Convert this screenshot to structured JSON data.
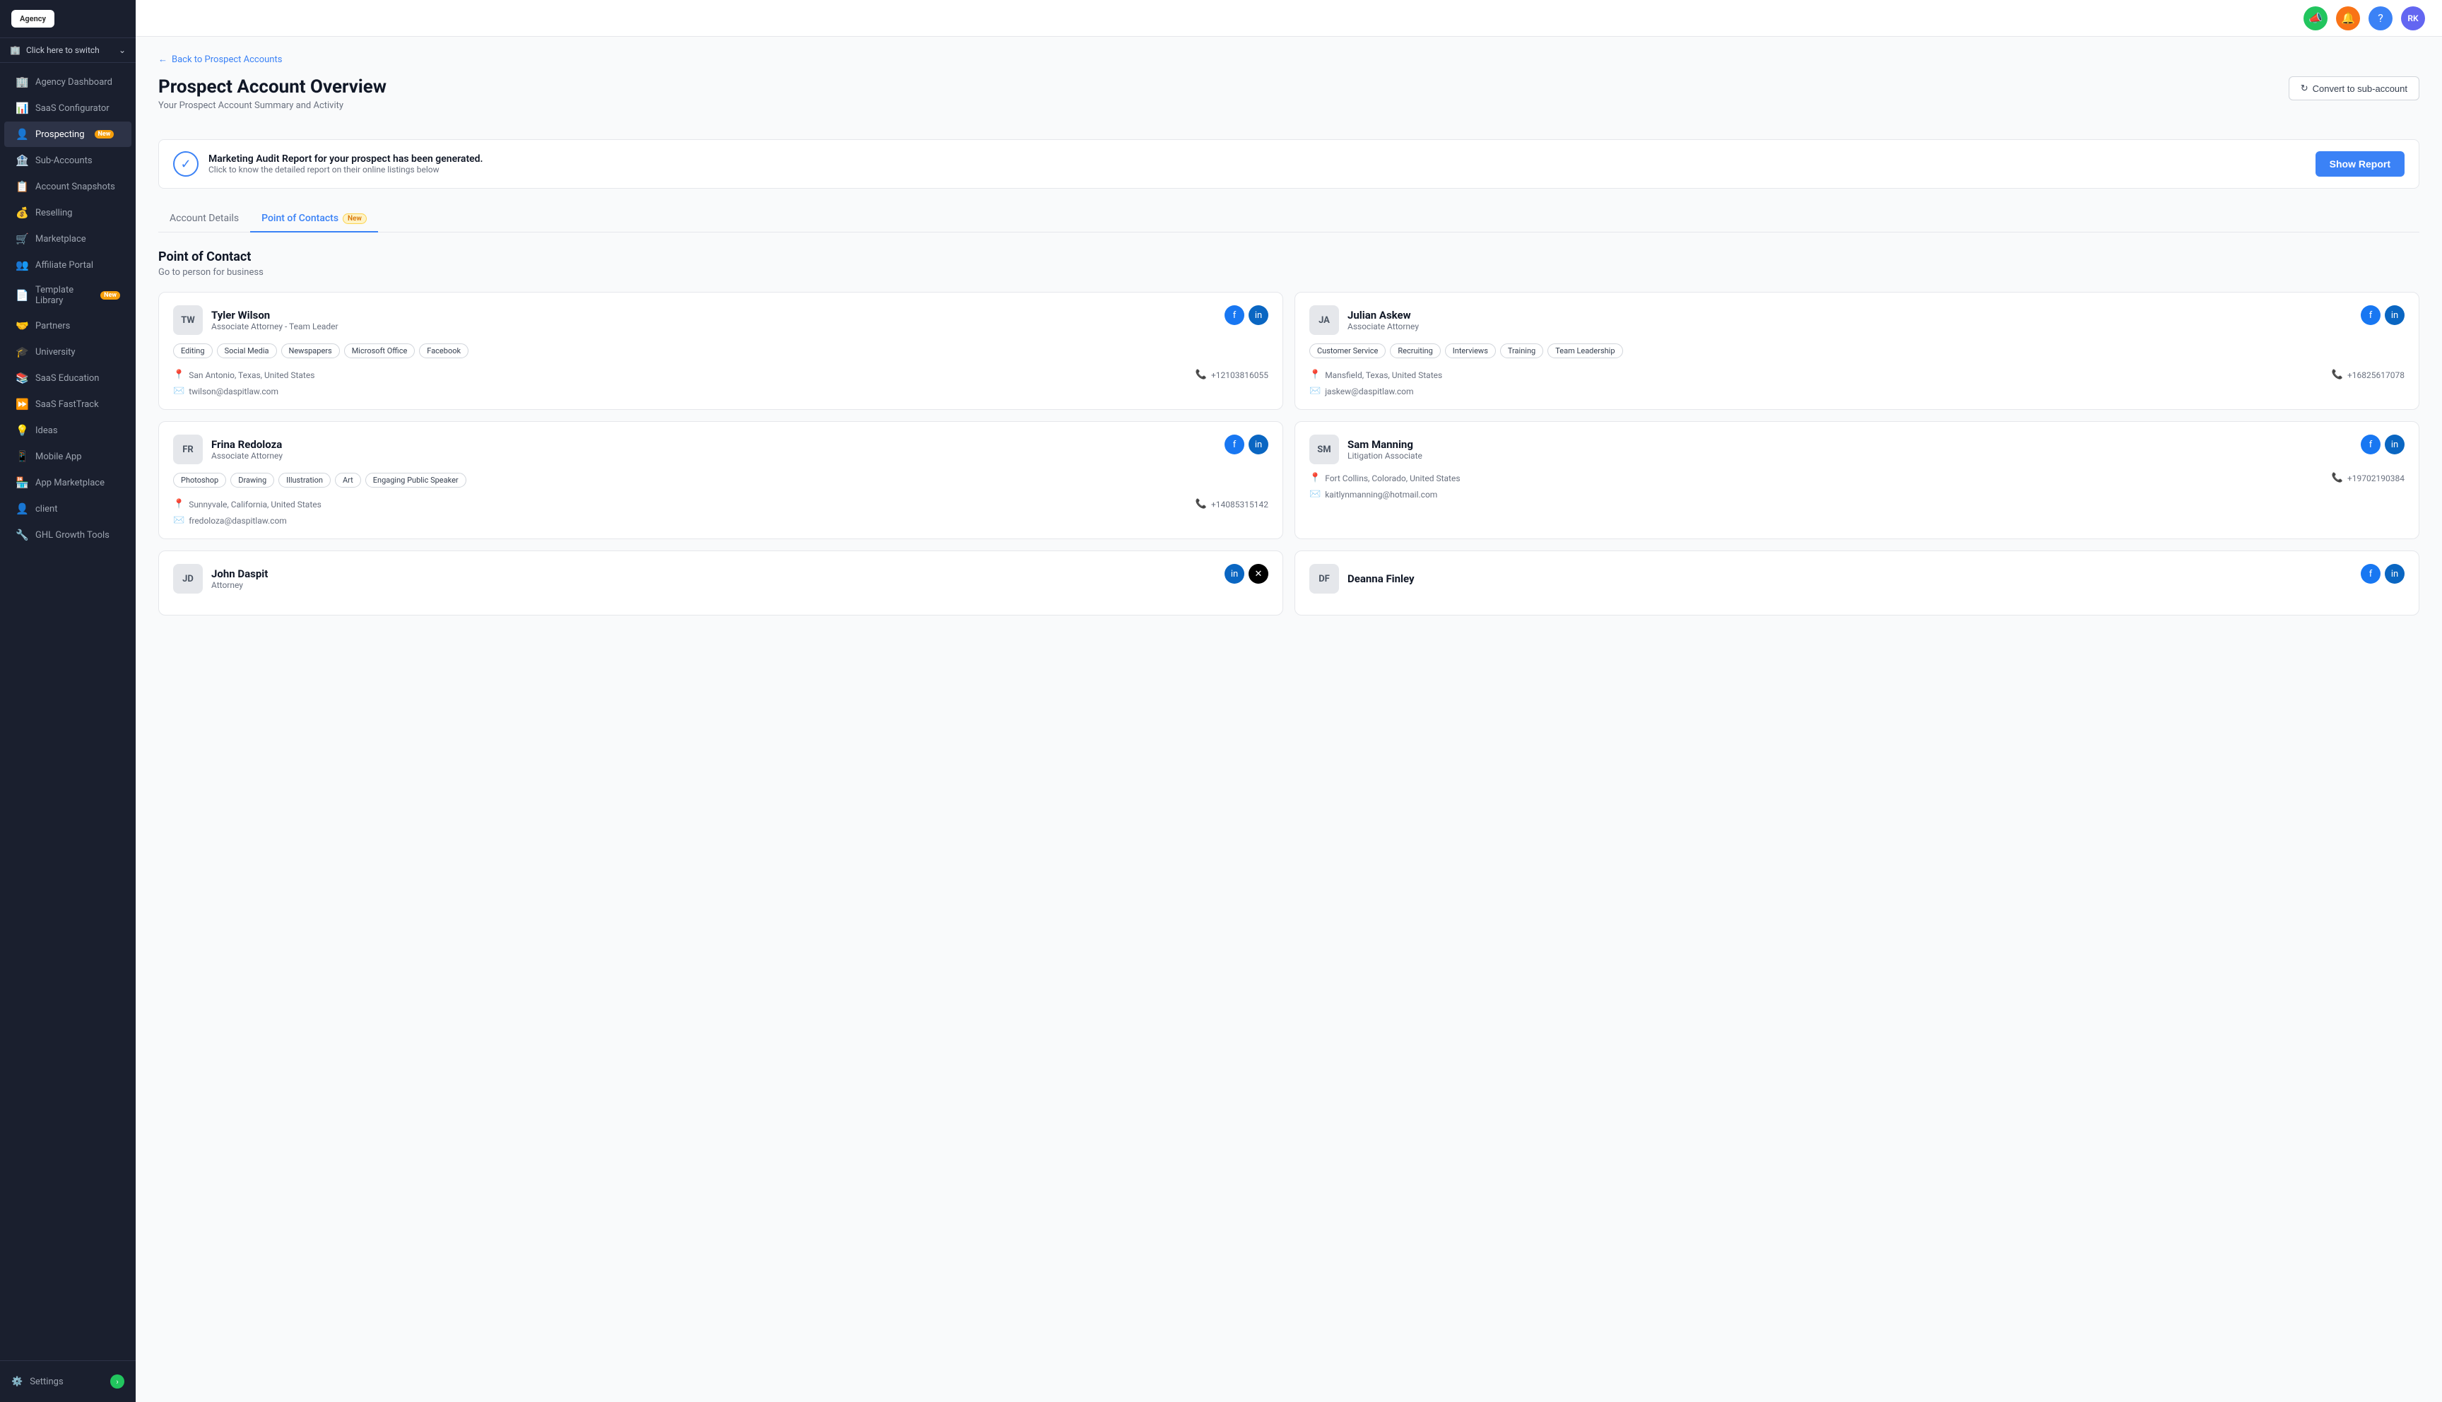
{
  "sidebar": {
    "logo": "Agency",
    "switch_label": "Click here to switch",
    "items": [
      {
        "id": "agency-dashboard",
        "label": "Agency Dashboard",
        "icon": "🏢",
        "badge": null
      },
      {
        "id": "saas-configurator",
        "label": "SaaS Configurator",
        "icon": "📊",
        "badge": null
      },
      {
        "id": "prospecting",
        "label": "Prospecting",
        "icon": "👤",
        "badge": "New"
      },
      {
        "id": "sub-accounts",
        "label": "Sub-Accounts",
        "icon": "🏦",
        "badge": null
      },
      {
        "id": "account-snapshots",
        "label": "Account Snapshots",
        "icon": "📋",
        "badge": null
      },
      {
        "id": "reselling",
        "label": "Reselling",
        "icon": "💰",
        "badge": null
      },
      {
        "id": "marketplace",
        "label": "Marketplace",
        "icon": "🛒",
        "badge": null
      },
      {
        "id": "affiliate-portal",
        "label": "Affiliate Portal",
        "icon": "👥",
        "badge": null
      },
      {
        "id": "template-library",
        "label": "Template Library",
        "icon": "📄",
        "badge": "New"
      },
      {
        "id": "partners",
        "label": "Partners",
        "icon": "🤝",
        "badge": null
      },
      {
        "id": "university",
        "label": "University",
        "icon": "🎓",
        "badge": null
      },
      {
        "id": "saas-education",
        "label": "SaaS Education",
        "icon": "📚",
        "badge": null
      },
      {
        "id": "saas-fasttrack",
        "label": "SaaS FastTrack",
        "icon": "⏩",
        "badge": null
      },
      {
        "id": "ideas",
        "label": "Ideas",
        "icon": "💡",
        "badge": null
      },
      {
        "id": "mobile-app",
        "label": "Mobile App",
        "icon": "📱",
        "badge": null
      },
      {
        "id": "app-marketplace",
        "label": "App Marketplace",
        "icon": "🏪",
        "badge": null
      },
      {
        "id": "client",
        "label": "client",
        "icon": "👤",
        "badge": null
      },
      {
        "id": "ghl-growth-tools",
        "label": "GHL Growth Tools",
        "icon": "🔧",
        "badge": null
      }
    ],
    "settings_label": "Settings"
  },
  "topbar": {
    "icons": [
      "🔔",
      "🔔",
      "?"
    ],
    "avatar_initials": "RK"
  },
  "page": {
    "back_label": "Back to Prospect Accounts",
    "title": "Prospect Account Overview",
    "subtitle": "Your Prospect Account Summary and Activity",
    "convert_btn": "Convert to sub-account"
  },
  "audit_banner": {
    "title": "Marketing Audit Report for your prospect has been generated.",
    "subtitle": "Click to know the detailed report on their online listings below",
    "button": "Show Report"
  },
  "tabs": [
    {
      "id": "account-details",
      "label": "Account Details",
      "badge": null
    },
    {
      "id": "point-of-contacts",
      "label": "Point of Contacts",
      "badge": "New"
    }
  ],
  "poc_section": {
    "title": "Point of Contact",
    "subtitle": "Go to person for business"
  },
  "contacts": [
    {
      "initials": "TW",
      "name": "Tyler Wilson",
      "role": "Associate Attorney - Team Leader",
      "skills": [
        "Editing",
        "Social Media",
        "Newspapers",
        "Microsoft Office",
        "Facebook"
      ],
      "location": "San Antonio, Texas, United States",
      "phone": "+12103816055",
      "email": "twilson@daspitlaw.com",
      "social": [
        "fb",
        "li"
      ]
    },
    {
      "initials": "JA",
      "name": "Julian Askew",
      "role": "Associate Attorney",
      "skills": [
        "Customer Service",
        "Recruiting",
        "Interviews",
        "Training",
        "Team Leadership"
      ],
      "location": "Mansfield, Texas, United States",
      "phone": "+16825617078",
      "email": "jaskew@daspitlaw.com",
      "social": [
        "fb",
        "li"
      ]
    },
    {
      "initials": "FR",
      "name": "Frina Redoloza",
      "role": "Associate Attorney",
      "skills": [
        "Photoshop",
        "Drawing",
        "Illustration",
        "Art",
        "Engaging Public Speaker"
      ],
      "location": "Sunnyvale, California, United States",
      "phone": "+14085315142",
      "email": "fredoloza@daspitlaw.com",
      "social": [
        "fb",
        "li"
      ]
    },
    {
      "initials": "SM",
      "name": "Sam Manning",
      "role": "Litigation Associate",
      "skills": [],
      "location": "Fort Collins, Colorado, United States",
      "phone": "+19702190384",
      "email": "kaitlynmanning@hotmail.com",
      "social": [
        "fb",
        "li"
      ]
    },
    {
      "initials": "JD",
      "name": "John Daspit",
      "role": "Attorney",
      "skills": [],
      "location": "",
      "phone": "",
      "email": "",
      "social": [
        "li",
        "tw"
      ]
    },
    {
      "initials": "DF",
      "name": "Deanna Finley",
      "role": "",
      "skills": [],
      "location": "",
      "phone": "",
      "email": "",
      "social": [
        "fb",
        "li"
      ]
    }
  ]
}
